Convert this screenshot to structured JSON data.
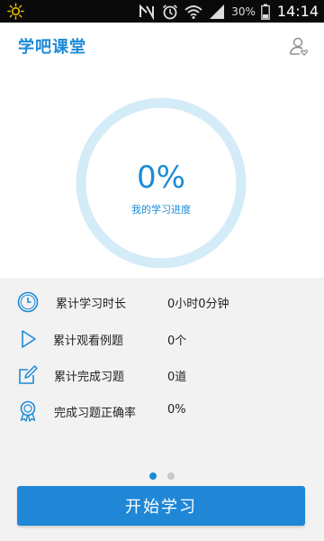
{
  "status_bar": {
    "battery_percent": "30%",
    "time": "14:14",
    "icons": [
      "weather-sun-icon",
      "nfc-icon",
      "alarm-icon",
      "wifi-icon",
      "signal-icon",
      "battery-icon"
    ]
  },
  "header": {
    "title": "学吧课堂",
    "profile_icon": "user-profile-icon"
  },
  "progress": {
    "percent_text": "0%",
    "value": 0,
    "caption": "我的学习进度"
  },
  "stats": [
    {
      "icon": "clock-icon",
      "label": "累计学习时长",
      "value": "0小时0分钟"
    },
    {
      "icon": "play-icon",
      "label": "累计观看例题",
      "value": "0个"
    },
    {
      "icon": "edit-icon",
      "label": "累计完成习题",
      "value": "0道"
    },
    {
      "icon": "badge-icon",
      "label": "完成习题正确率",
      "value": "0%"
    }
  ],
  "pager": {
    "count": 2,
    "active_index": 0
  },
  "start_button": {
    "label": "开始学习"
  },
  "colors": {
    "accent": "#1b8bd7",
    "ring_track": "#d4ebf8",
    "panel_background": "#f2f2f2",
    "status_bar": "#0a0a0a"
  }
}
